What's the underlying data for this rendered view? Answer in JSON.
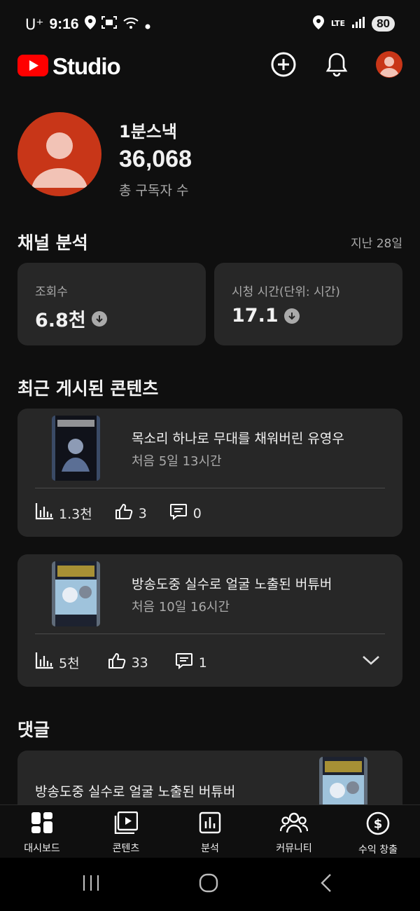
{
  "status_bar": {
    "carrier": "U⁺",
    "time": "9:16",
    "network": "LTE",
    "battery": "80"
  },
  "app_bar": {
    "logo_text": "Studio",
    "brand_color": "#ff0000"
  },
  "channel": {
    "name": "1분스낵",
    "subscriber_count": "36,068",
    "subscriber_label": "총 구독자 수",
    "avatar_color": "#c83618"
  },
  "analytics": {
    "title": "채널 분석",
    "period": "지난 28일",
    "cards": [
      {
        "label": "조회수",
        "value": "6.8천",
        "trend": "down"
      },
      {
        "label": "시청 시간(단위: 시간)",
        "value": "17.1",
        "trend": "down"
      }
    ]
  },
  "recent_content": {
    "title": "최근 게시된 콘텐츠",
    "videos": [
      {
        "title": "목소리 하나로 무대를 채워버린 유영우",
        "meta": "처음 5일 13시간",
        "views": "1.3천",
        "likes": "3",
        "comments": "0"
      },
      {
        "title": "방송도중 실수로 얼굴 노출된 버튜버",
        "meta": "처음 10일 16시간",
        "views": "5천",
        "likes": "33",
        "comments": "1"
      }
    ]
  },
  "comments": {
    "title": "댓글",
    "items": [
      {
        "video_title": "방송도중 실수로 얼굴 노출된 버튜버"
      }
    ]
  },
  "bottom_nav": {
    "items": [
      {
        "label": "대시보드",
        "icon": "dashboard-icon"
      },
      {
        "label": "콘텐츠",
        "icon": "content-icon"
      },
      {
        "label": "분석",
        "icon": "analytics-icon"
      },
      {
        "label": "커뮤니티",
        "icon": "community-icon"
      },
      {
        "label": "수익 창출",
        "icon": "monetization-icon"
      }
    ]
  }
}
